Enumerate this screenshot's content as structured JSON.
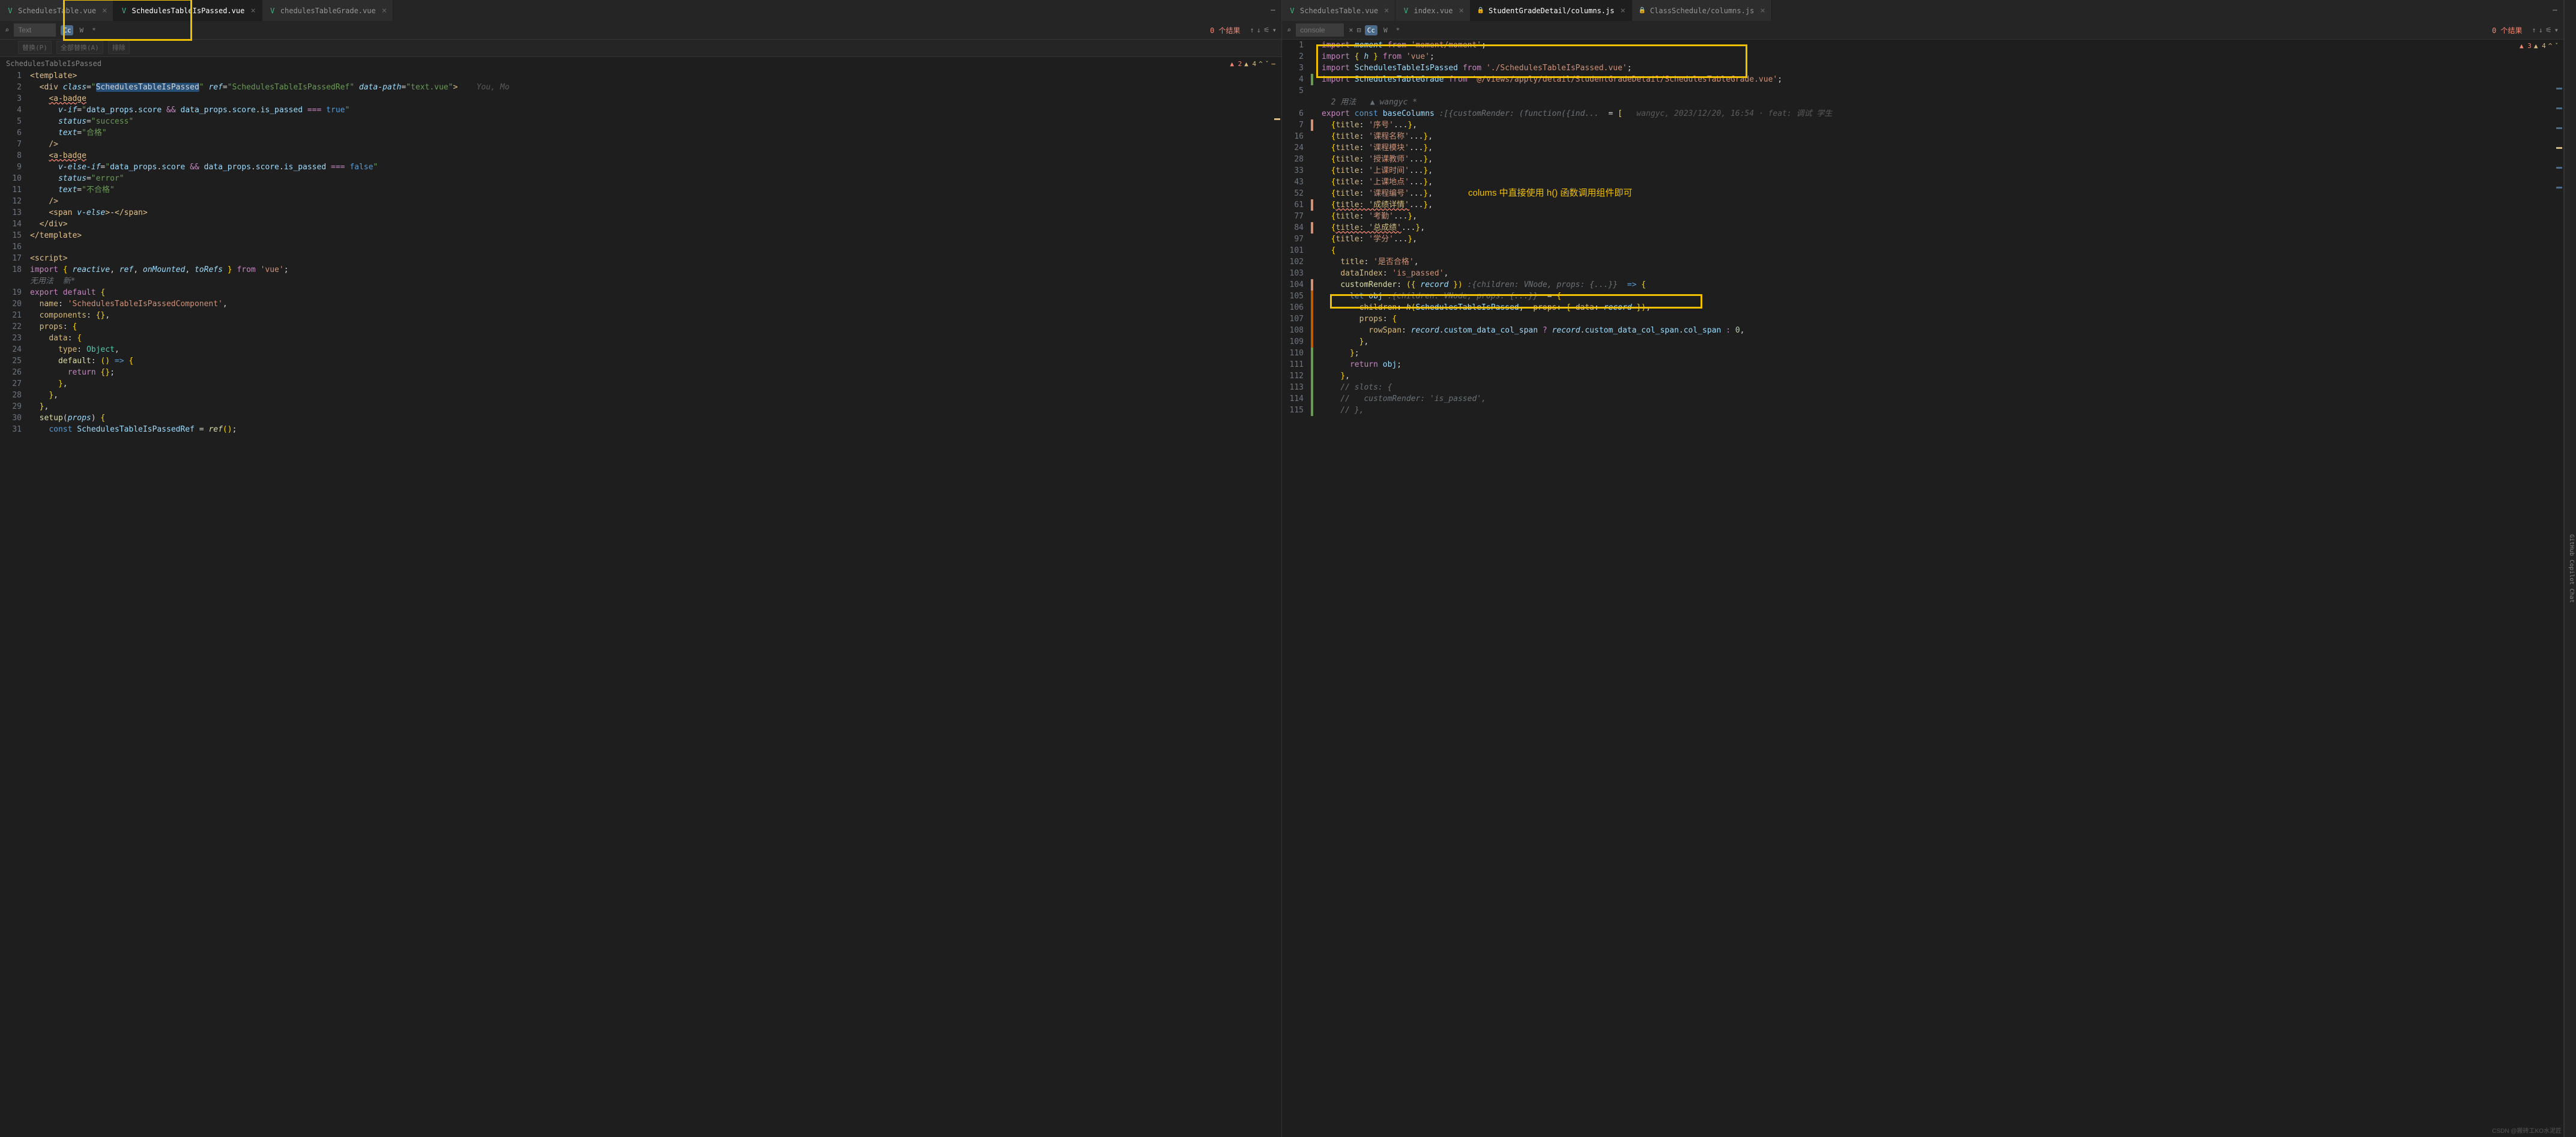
{
  "leftPane": {
    "tabs": [
      {
        "icon": "vue",
        "label": "SchedulesTable.vue",
        "active": false
      },
      {
        "icon": "vue",
        "label": "SchedulesTableIsPassed.vue",
        "active": true
      },
      {
        "icon": "vue",
        "label": "chedulesTableGrade.vue",
        "active": false
      }
    ],
    "search": {
      "placeholder": "Text",
      "results": "0 个结果",
      "cc": "Cc",
      "w": "W",
      "star": "*"
    },
    "replace": {
      "p1": "替换(P)",
      "p2": "全部替换(A)",
      "p3": "排除"
    },
    "breadcrumb": "SchedulesTableIsPassed",
    "warnings": {
      "err": "▲ 2",
      "warn": "▲ 4"
    },
    "lines": [
      {
        "n": "1",
        "html": "<span class='tag'>&lt;template&gt;</span>"
      },
      {
        "n": "2",
        "html": "  <span class='tag'>&lt;div</span> <span class='attr italic'>class</span>=<span class='str'>\"</span><span class='sel'>SchedulesTableIsPassed</span><span class='str'>\"</span> <span class='attr italic'>ref</span>=<span class='str'>\"SchedulesTableIsPassedRef\"</span> <span class='attr italic'>data-path</span>=<span class='str'>\"text.vue\"</span><span class='tag'>&gt;</span>    <span class='author-hint'>You, Mo</span>"
      },
      {
        "n": "3",
        "html": "    <span class='tag wavy'>&lt;a-badge</span>"
      },
      {
        "n": "4",
        "html": "      <span class='attr italic'>v-if</span>=<span class='str'>\"</span><span class='id'>data_props</span>.<span class='id'>score</span> <span class='kw'>&amp;&amp;</span> <span class='id'>data_props</span>.<span class='id'>score</span>.<span class='id'>is_passed</span> <span class='kw'>===</span> <span class='kw2'>true</span><span class='str'>\"</span>"
      },
      {
        "n": "5",
        "html": "      <span class='attr italic'>status</span>=<span class='str'>\"success\"</span>"
      },
      {
        "n": "6",
        "html": "      <span class='attr italic'>text</span>=<span class='str'>\"合格\"</span>"
      },
      {
        "n": "7",
        "html": "    <span class='tag'>/&gt;</span>"
      },
      {
        "n": "8",
        "html": "    <span class='tag wavy'>&lt;a-badge</span>"
      },
      {
        "n": "9",
        "html": "      <span class='attr italic'>v-else-if</span>=<span class='str'>\"</span><span class='id'>data_props</span>.<span class='id'>score</span> <span class='kw'>&amp;&amp;</span> <span class='id'>data_props</span>.<span class='id'>score</span>.<span class='id'>is_passed</span> <span class='kw'>===</span> <span class='kw2'>false</span><span class='str'>\"</span>"
      },
      {
        "n": "10",
        "html": "      <span class='attr italic'>status</span>=<span class='str'>\"error\"</span>"
      },
      {
        "n": "11",
        "html": "      <span class='attr italic'>text</span>=<span class='str'>\"不合格\"</span>"
      },
      {
        "n": "12",
        "html": "    <span class='tag'>/&gt;</span>"
      },
      {
        "n": "13",
        "html": "    <span class='tag'>&lt;span</span> <span class='attr italic'>v-else</span><span class='tag'>&gt;</span>-<span class='tag'>&lt;/span&gt;</span>"
      },
      {
        "n": "14",
        "html": "  <span class='tag'>&lt;/div&gt;</span>"
      },
      {
        "n": "15",
        "html": "<span class='tag'>&lt;/template&gt;</span>"
      },
      {
        "n": "16",
        "html": ""
      },
      {
        "n": "17",
        "html": "<span class='tag'>&lt;script&gt;</span>"
      },
      {
        "n": "18",
        "html": "<span class='kw'>import</span> <span class='br'>{</span> <span class='id italic'>reactive</span>, <span class='id italic'>ref</span>, <span class='id italic'>onMounted</span>, <span class='id italic'>toRefs</span> <span class='br'>}</span> <span class='kw'>from</span> <span class='strv'>'vue'</span>;"
      },
      {
        "n": "",
        "html": "<span class='cm'>无用法  新*</span>"
      },
      {
        "n": "19",
        "html": "<span class='kw'>export</span> <span class='kw'>default</span> <span class='br'>{</span>"
      },
      {
        "n": "20",
        "html": "  <span class='prop'>name</span>: <span class='strv'>'SchedulesTableIsPassedComponent'</span>,"
      },
      {
        "n": "21",
        "html": "  <span class='prop'>components</span>: <span class='br'>{}</span>,"
      },
      {
        "n": "22",
        "html": "  <span class='prop'>props</span>: <span class='br'>{</span>"
      },
      {
        "n": "23",
        "html": "    <span class='prop'>data</span>: <span class='br'>{</span>"
      },
      {
        "n": "24",
        "html": "      <span class='prop'>type</span>: <span class='tp'>Object</span>,"
      },
      {
        "n": "25",
        "html": "      <span class='fn'>default</span>: <span class='br'>()</span> <span class='kw2'>=&gt;</span> <span class='br'>{</span>"
      },
      {
        "n": "26",
        "html": "        <span class='kw'>return</span> <span class='br'>{}</span>;"
      },
      {
        "n": "27",
        "html": "      <span class='br'>}</span>,"
      },
      {
        "n": "28",
        "html": "    <span class='br'>}</span>,"
      },
      {
        "n": "29",
        "html": "  <span class='br'>}</span>,"
      },
      {
        "n": "30",
        "html": "  <span class='fn'>setup</span>(<span class='id italic'>props</span>) <span class='br'>{</span>"
      },
      {
        "n": "31",
        "html": "    <span class='kw2'>const</span> <span class='id'>SchedulesTableIsPassedRef</span> = <span class='fn italic'>ref</span><span class='br'>()</span>;"
      }
    ]
  },
  "rightPane": {
    "tabs": [
      {
        "icon": "vue",
        "label": "SchedulesTable.vue",
        "active": false
      },
      {
        "icon": "vue",
        "label": "index.vue",
        "active": false
      },
      {
        "icon": "js-lock",
        "label": "StudentGradeDetail/columns.js",
        "active": true
      },
      {
        "icon": "js-lock",
        "label": "ClassSchedule/columns.js",
        "active": false
      }
    ],
    "search": {
      "placeholder": "console",
      "results": "0 个结果",
      "cc": "Cc",
      "w": "W",
      "star": "*"
    },
    "usageHint": "2 用法",
    "authorHint": "wangyc *",
    "inlineMeta": "wangyc, 2023/12/20, 16:54 · feat: 调试 学生",
    "warnings": {
      "err": "▲ 3",
      "warn": "▲ 4"
    },
    "annotation": "colums 中直接使用 h() 函数调用组件即可",
    "lines": [
      {
        "n": "1",
        "fm": "",
        "html": "<span class='kw'>import</span> <span class='id italic'>moment</span> <span class='kw'>from</span> <span class='strv'>'moment/moment'</span>;"
      },
      {
        "n": "2",
        "fm": "",
        "html": "<span class='kw'>import</span> <span class='br'>{</span> <span class='id italic'>h</span> <span class='br'>}</span> <span class='kw'>from</span> <span class='strv'>'vue'</span>;"
      },
      {
        "n": "3",
        "fm": "",
        "html": "<span class='kw'>import</span> <span class='id'>SchedulesTableIsPassed</span> <span class='kw'>from</span> <span class='strv'>'./SchedulesTableIsPassed.vue'</span>;"
      },
      {
        "n": "4",
        "fm": "fm-green",
        "html": "<span class='kw'>import</span> <span class='id'>SchedulesTableGrade</span> <span class='kw'>from</span> <span class='strv'>'@/views/apply/detail/StudentGradeDetail/SchedulesTableGrade.vue'</span>;"
      },
      {
        "n": "5",
        "fm": "",
        "html": ""
      },
      {
        "n": "",
        "fm": "",
        "html": "  <span class='cm'>2 用法   ▲ wangyc *</span>"
      },
      {
        "n": "6",
        "fm": "",
        "html": "<span class='kw'>export</span> <span class='kw2'>const</span> <span class='id'>baseColumns</span> <span class='cm'>:[{customRender: (function({ind...</span>  = <span class='br'>[</span>   <span class='author-hint'>wangyc, 2023/12/20, 16:54 · feat: 调试 学生</span>"
      },
      {
        "n": "7",
        "fm": "fm-orange",
        "html": "  <span class='br'>{</span><span class='prop'>title</span>: <span class='strv'>'序号'</span>...<span class='br'>}</span>,"
      },
      {
        "n": "16",
        "fm": "",
        "html": "  <span class='br'>{</span><span class='prop'>title</span>: <span class='strv'>'课程名称'</span>...<span class='br'>}</span>,"
      },
      {
        "n": "24",
        "fm": "",
        "html": "  <span class='br'>{</span><span class='prop'>title</span>: <span class='strv'>'课程模块'</span>...<span class='br'>}</span>,"
      },
      {
        "n": "28",
        "fm": "",
        "html": "  <span class='br'>{</span><span class='prop'>title</span>: <span class='strv'>'授课教师'</span>...<span class='br'>}</span>,"
      },
      {
        "n": "33",
        "fm": "",
        "html": "  <span class='br'>{</span><span class='prop'>title</span>: <span class='strv'>'上课时间'</span>...<span class='br'>}</span>,"
      },
      {
        "n": "43",
        "fm": "",
        "html": "  <span class='br'>{</span><span class='prop'>title</span>: <span class='strv'>'上课地点'</span>...<span class='br'>}</span>,"
      },
      {
        "n": "52",
        "fm": "",
        "html": "  <span class='br'>{</span><span class='prop'>title</span>: <span class='strv'>'课程编号'</span>...<span class='br'>}</span>,"
      },
      {
        "n": "61",
        "fm": "fm-orange",
        "html": "  <span class='br'>{</span><span class='prop wavy'>title: '成绩详情'</span>...<span class='br'>}</span>,"
      },
      {
        "n": "77",
        "fm": "",
        "html": "  <span class='br'>{</span><span class='prop'>title</span>: <span class='strv'>'考勤'</span>...<span class='br'>}</span>,"
      },
      {
        "n": "84",
        "fm": "fm-orange",
        "html": "  <span class='br'>{</span><span class='prop wavy'>title: '总成绩'</span>...<span class='br'>}</span>,"
      },
      {
        "n": "97",
        "fm": "",
        "html": "  <span class='br'>{</span><span class='prop'>title</span>: <span class='strv'>'学分'</span>...<span class='br'>}</span>,"
      },
      {
        "n": "101",
        "fm": "",
        "html": "  <span class='br'>{</span>"
      },
      {
        "n": "102",
        "fm": "",
        "html": "    <span class='prop'>title</span>: <span class='strv'>'是否合格'</span>,"
      },
      {
        "n": "103",
        "fm": "",
        "html": "    <span class='prop'>dataIndex</span>: <span class='strv'>'is_passed'</span>,"
      },
      {
        "n": "104",
        "fm": "fm-orange",
        "html": "    <span class='fn'>customRender</span>: <span class='br'>({</span> <span class='id italic'>record</span> <span class='br'>})</span> <span class='cm'>:{children: VNode, props: {...}}</span>  <span class='kw2'>=&gt;</span> <span class='br'>{</span>"
      },
      {
        "n": "105",
        "fm": "fm-dkorange",
        "html": "      <span class='kw2'>let</span> <span class='id'>obj</span> <span class='cm'>:{children: VNode, props: {...}}</span>  = <span class='br'>{</span>"
      },
      {
        "n": "106",
        "fm": "fm-dkorange",
        "html": "        <span class='prop'>children</span>: <span class='fn italic'>h</span><span class='br'>(</span><span class='id'>SchedulesTableIsPassed</span>,  <span class='prop'>props:</span> <span class='br'>{</span> <span class='prop'>data</span>: <span class='id italic'>record</span> <span class='br'>})</span>,"
      },
      {
        "n": "107",
        "fm": "fm-dkorange",
        "html": "        <span class='prop'>props</span>: <span class='br'>{</span>"
      },
      {
        "n": "108",
        "fm": "fm-dkorange",
        "html": "          <span class='prop'>rowSpan</span>: <span class='id italic'>record</span>.<span class='id'>custom_data_col_span</span> <span class='kw'>?</span> <span class='id italic'>record</span>.<span class='id'>custom_data_col_span</span>.<span class='id'>col_span</span> <span class='kw'>:</span> <span class='num'>0</span>,"
      },
      {
        "n": "109",
        "fm": "fm-dkorange",
        "html": "        <span class='br'>}</span>,"
      },
      {
        "n": "110",
        "fm": "fm-green",
        "html": "      <span class='br'>}</span>;"
      },
      {
        "n": "111",
        "fm": "fm-green",
        "html": "      <span class='kw'>return</span> <span class='id'>obj</span>;"
      },
      {
        "n": "112",
        "fm": "fm-green",
        "html": "    <span class='br'>}</span>,"
      },
      {
        "n": "113",
        "fm": "fm-green",
        "html": "    <span class='cm'>// slots: {</span>"
      },
      {
        "n": "114",
        "fm": "fm-green",
        "html": "    <span class='cm'>//   customRender: 'is_passed',</span>"
      },
      {
        "n": "115",
        "fm": "fm-green",
        "html": "    <span class='cm'>// },</span>"
      }
    ]
  },
  "sidebar": {
    "copilot": "GitHub Copilot Chat"
  },
  "watermark": "CSDN @搬砖工KO水泥匠"
}
